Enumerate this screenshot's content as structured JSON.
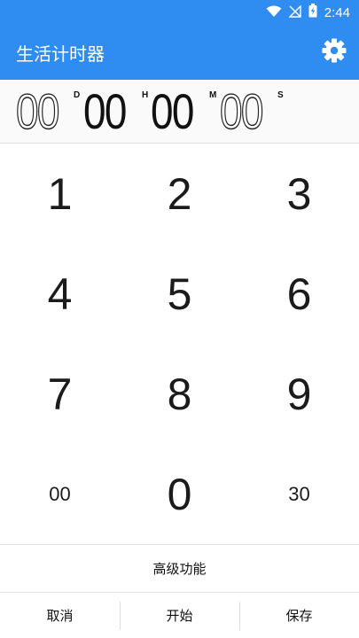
{
  "status": {
    "time": "2:44",
    "wifi_icon": "wifi-icon",
    "signal_icon": "no-signal-icon",
    "battery_icon": "battery-charging-icon"
  },
  "app": {
    "title": "生活计时器",
    "settings_icon": "gear-icon",
    "accent": "#2f8cf0"
  },
  "timer": {
    "days": "00",
    "days_unit": "D",
    "hours": "00",
    "hours_unit": "H",
    "minutes": "00",
    "minutes_unit": "M",
    "seconds": "00",
    "seconds_unit": "S"
  },
  "keypad": {
    "k1": "1",
    "k2": "2",
    "k3": "3",
    "k4": "4",
    "k5": "5",
    "k6": "6",
    "k7": "7",
    "k8": "8",
    "k9": "9",
    "k00": "00",
    "k0": "0",
    "k30": "30"
  },
  "advanced": {
    "label": "高级功能"
  },
  "actions": {
    "cancel": "取消",
    "start": "开始",
    "save": "保存"
  }
}
